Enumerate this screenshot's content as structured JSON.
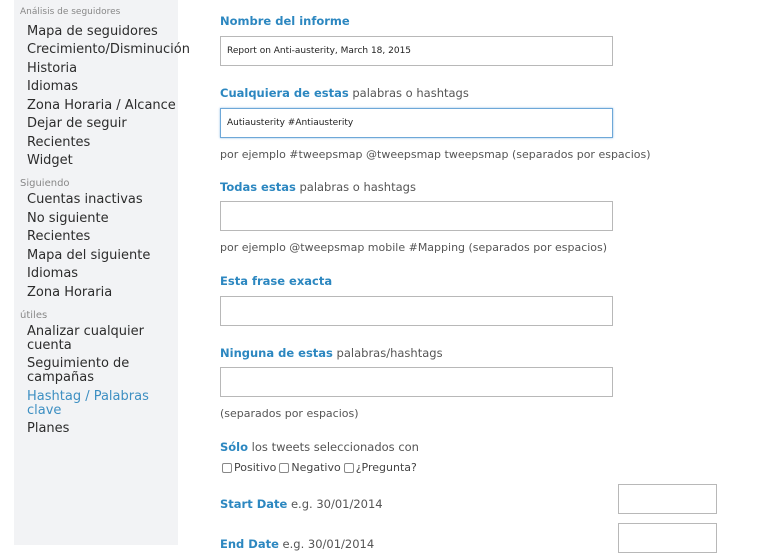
{
  "sidebar": {
    "top_clipped": "Análisis de seguidores",
    "group1": [
      "Mapa de seguidores",
      "Crecimiento/Disminución",
      "Historia",
      "Idiomas",
      "Zona Horaria / Alcance",
      "Dejar de seguir",
      "Recientes",
      "Widget"
    ],
    "section2": "Siguiendo",
    "group2": [
      "Cuentas inactivas",
      "No siguiente",
      "Recientes",
      "Mapa del siguiente",
      "Idiomas",
      "Zona Horaria"
    ],
    "section3": "útiles",
    "group3": [
      "Analizar cualquier cuenta",
      "Seguimiento de campañas",
      "Hashtag / Palabras clave",
      "Planes"
    ]
  },
  "form": {
    "report_name_label": "Nombre del informe",
    "report_name_value": "Report on Anti-austerity, March 18, 2015",
    "any_words_bold": "Cualquiera de estas",
    "any_words_rest": " palabras o hashtags",
    "any_words_value": "Autiausterity #Antiausterity",
    "any_words_hint": "por ejemplo #tweepsmap @tweepsmap tweepsmap (separados por espacios)",
    "all_words_bold": "Todas estas",
    "all_words_rest": " palabras o hashtags",
    "all_words_value": "",
    "all_words_hint": "por ejemplo @tweepsmap mobile #Mapping (separados por espacios)",
    "exact_phrase_label": "Esta frase exacta",
    "exact_phrase_value": "",
    "none_words_bold": "Ninguna de estas",
    "none_words_rest": " palabras/hashtags",
    "none_words_value": "",
    "none_words_hint": "(separados por espacios)",
    "only_bold": "Sólo",
    "only_rest": " los tweets seleccionados con",
    "options": [
      "Positivo",
      "Negativo",
      "¿Pregunta?"
    ],
    "start_date_bold": "Start Date",
    "start_date_rest": " e.g. 30/01/2014",
    "end_date_bold": "End Date",
    "end_date_rest": " e.g. 30/01/2014"
  }
}
